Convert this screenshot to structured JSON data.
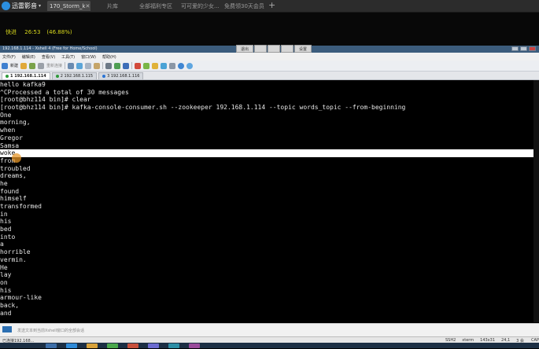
{
  "player": {
    "app_name": "迅雷影音",
    "tabs": [
      {
        "label": "170_Storm_k",
        "active": true
      },
      {
        "label": "片库"
      },
      {
        "label": "全部福利专区"
      },
      {
        "label": "可可爱的少女..."
      },
      {
        "label": "免费领30天会员"
      }
    ],
    "status": {
      "mode": "快进",
      "time": "26:53",
      "percent": "(46.88%)"
    }
  },
  "xshell": {
    "title": "192.168.1.114 - Xshell 4 (Free for Home/School)",
    "float_toolbar": [
      "退出",
      "",
      "",
      "",
      "设置"
    ],
    "menu": [
      "文件(F)",
      "编辑(E)",
      "查看(V)",
      "工具(T)",
      "窗口(W)",
      "帮助(H)"
    ],
    "toolbar": {
      "new_label": "新建",
      "reconnect_label": "重新连接"
    },
    "session_tabs": [
      {
        "label": "1 192.168.1.114",
        "active": true
      },
      {
        "label": "2 192.168.1.115"
      },
      {
        "label": "3 192.168.1.116"
      }
    ],
    "terminal_lines": [
      "hello kafka9",
      "^CProcessed a total of 30 messages",
      "[root@bhz114 bin]# clear",
      "[root@bhz114 bin]# kafka-console-consumer.sh --zookeeper 192.168.1.114 --topic words_topic --from-beginning",
      "One",
      "morning,",
      "when",
      "Gregor",
      "Samsa",
      "woke",
      "from",
      "troubled",
      "dreams,",
      "he",
      "found",
      "himself",
      "transformed",
      "in",
      "his",
      "bed",
      "into",
      "a",
      "horrible",
      "vermin.",
      "He",
      "lay",
      "on",
      "his",
      "armour-like",
      "back,",
      "and"
    ],
    "highlight_index": 9,
    "compose_placeholder": "发送文本到当前Xshell窗口的全部会话",
    "status": {
      "left": "已连接192.168...",
      "ssh": "SSH2",
      "term": "xterm",
      "size": "143x31",
      "cursor": "24,1",
      "sessions": "3 会话",
      "caps": "CAP"
    }
  },
  "colors": {
    "title_bar": "#3c5c7c",
    "status_yellow": "#d8d81c",
    "terminal_bg": "#000000",
    "terminal_fg": "#e6e6e6"
  }
}
